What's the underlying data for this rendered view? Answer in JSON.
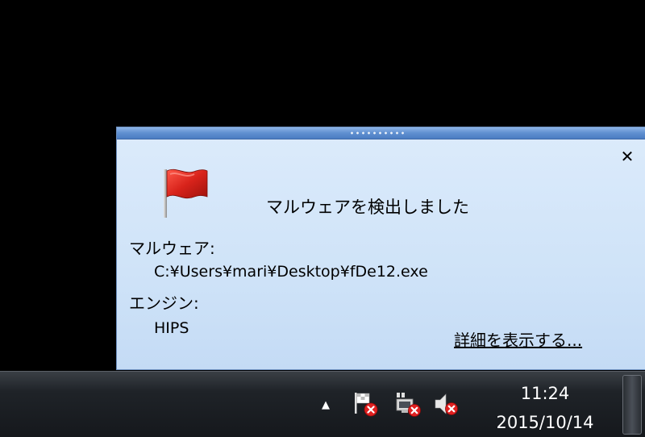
{
  "popup": {
    "title": "マルウェアを検出しました",
    "close_label": "✕",
    "malware_label": "マルウェア:",
    "malware_value": "C:¥Users¥mari¥Desktop¥fDe12.exe",
    "engine_label": "エンジン:",
    "engine_value": "HIPS",
    "details_link": "詳細を表示する..."
  },
  "taskbar": {
    "tray_arrow": "▲",
    "clock_time": "11:24",
    "clock_date": "2015/10/14",
    "icons": [
      "flag-error-icon",
      "network-error-icon",
      "volume-muted-icon"
    ]
  },
  "colors": {
    "popup_bg": "#d4e6f9",
    "popup_border": "#6c8fbf",
    "title_bar": "#5f8fd0",
    "flag_red": "#d8231b",
    "error_red": "#e02020",
    "taskbar": "#1f2328"
  }
}
